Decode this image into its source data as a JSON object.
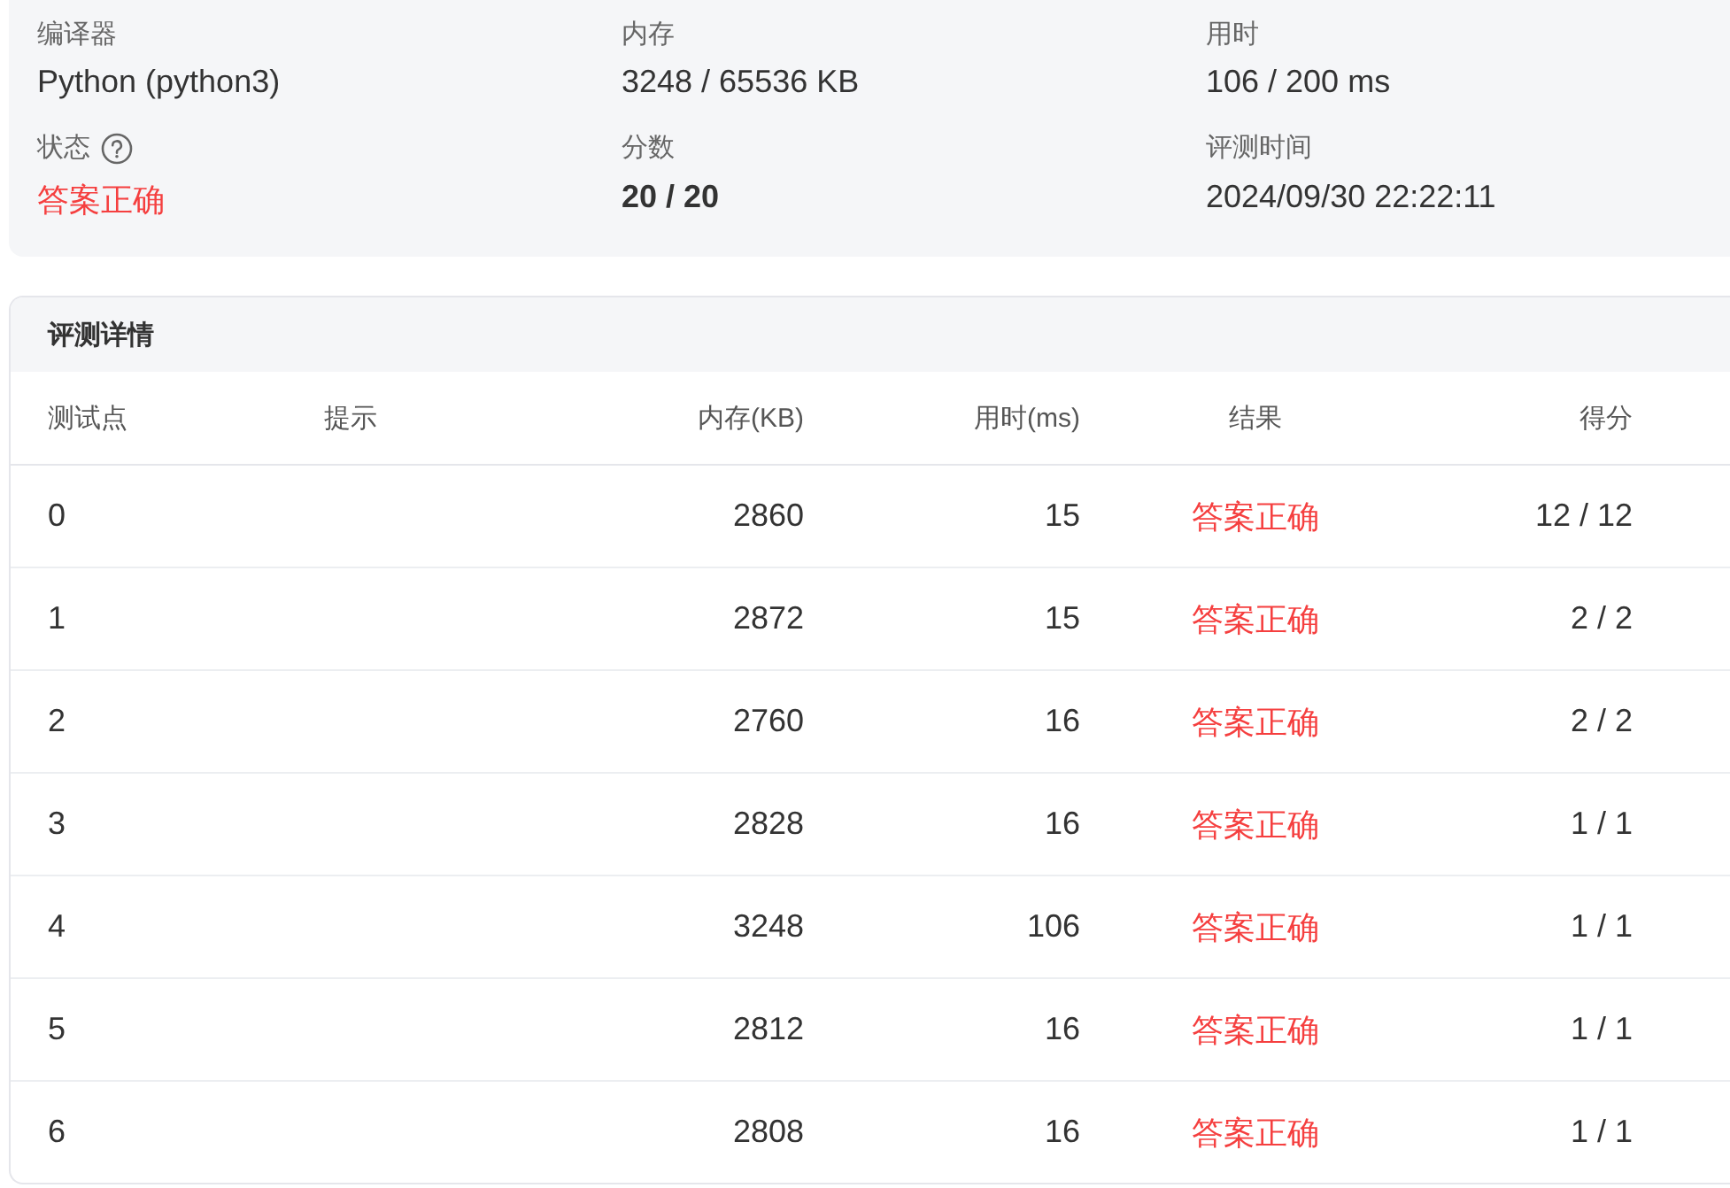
{
  "summary": [
    {
      "label": "编译器",
      "value": "Python (python3)",
      "kind": "plain"
    },
    {
      "label": "内存",
      "value": "3248 / 65536 KB",
      "kind": "plain"
    },
    {
      "label": "用时",
      "value": "106 / 200 ms",
      "kind": "plain"
    },
    {
      "label": "状态",
      "value": "答案正确",
      "kind": "status",
      "accepted": true,
      "help": true
    },
    {
      "label": "分数",
      "value": "20 / 20",
      "kind": "bold"
    },
    {
      "label": "评测时间",
      "value": "2024/09/30 22:22:11",
      "kind": "plain"
    }
  ],
  "details": {
    "title": "评测详情",
    "columns": [
      "测试点",
      "提示",
      "内存(KB)",
      "用时(ms)",
      "结果",
      "得分"
    ],
    "rows": [
      {
        "case": "0",
        "memory": "2860",
        "time": "15",
        "result": "答案正确",
        "accepted": true,
        "score": "12 / 12"
      },
      {
        "case": "1",
        "memory": "2872",
        "time": "15",
        "result": "答案正确",
        "accepted": true,
        "score": "2 / 2"
      },
      {
        "case": "2",
        "memory": "2760",
        "time": "16",
        "result": "答案正确",
        "accepted": true,
        "score": "2 / 2"
      },
      {
        "case": "3",
        "memory": "2828",
        "time": "16",
        "result": "答案正确",
        "accepted": true,
        "score": "1 / 1"
      },
      {
        "case": "4",
        "memory": "3248",
        "time": "106",
        "result": "答案正确",
        "accepted": true,
        "score": "1 / 1"
      },
      {
        "case": "5",
        "memory": "2812",
        "time": "16",
        "result": "答案正确",
        "accepted": true,
        "score": "1 / 1"
      },
      {
        "case": "6",
        "memory": "2808",
        "time": "16",
        "result": "答案正确",
        "accepted": true,
        "score": "1 / 1"
      }
    ]
  }
}
